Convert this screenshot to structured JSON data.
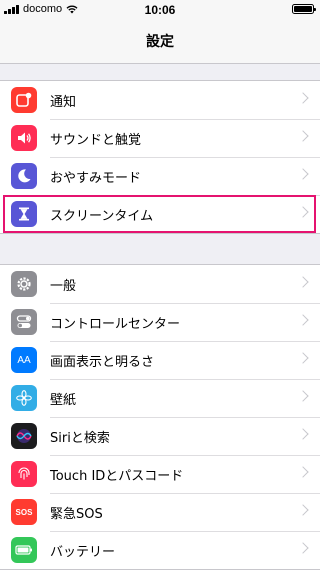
{
  "status_bar": {
    "carrier": "docomo",
    "time": "10:06"
  },
  "nav": {
    "title": "設定"
  },
  "groups": [
    {
      "items": [
        {
          "label": "通知",
          "icon": "notifications-icon",
          "color": "#ff3b30"
        },
        {
          "label": "サウンドと触覚",
          "icon": "speaker-icon",
          "color": "#ff2d55"
        },
        {
          "label": "おやすみモード",
          "icon": "moon-icon",
          "color": "#5856d6"
        },
        {
          "label": "スクリーンタイム",
          "icon": "hourglass-icon",
          "color": "#5856d6"
        }
      ]
    },
    {
      "items": [
        {
          "label": "一般",
          "icon": "gear-icon",
          "color": "#8e8e93"
        },
        {
          "label": "コントロールセンター",
          "icon": "toggles-icon",
          "color": "#8e8e93"
        },
        {
          "label": "画面表示と明るさ",
          "icon": "text-size-icon",
          "color": "#007aff"
        },
        {
          "label": "壁紙",
          "icon": "flower-icon",
          "color": "#32ade6"
        },
        {
          "label": "Siriと検索",
          "icon": "siri-icon",
          "color": "#1c1c1e"
        },
        {
          "label": "Touch IDとパスコード",
          "icon": "fingerprint-icon",
          "color": "#ff2d55"
        },
        {
          "label": "緊急SOS",
          "icon": "sos-icon",
          "color": "#ff3b30"
        },
        {
          "label": "バッテリー",
          "icon": "battery-icon",
          "color": "#34c759"
        }
      ]
    }
  ],
  "highlight": {
    "target": "スクリーンタイム",
    "color": "#e5136f"
  },
  "icons": {
    "sos_text": "SOS",
    "text_size_text": "AA"
  }
}
